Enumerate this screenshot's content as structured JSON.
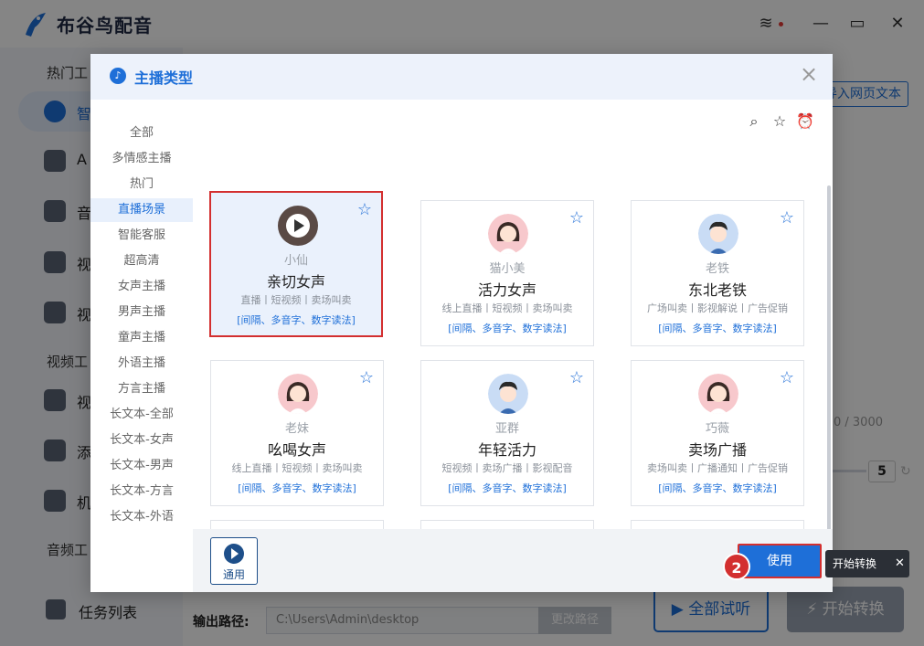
{
  "app": {
    "title": "布谷鸟配音",
    "sections": {
      "hot": "热门工",
      "video": "视频工",
      "audio": "音频工"
    },
    "nav_items": [
      {
        "label": "智",
        "icon": "voice-icon"
      },
      {
        "label": "A",
        "icon": "ai-icon"
      },
      {
        "label": "音",
        "icon": "audio-icon"
      },
      {
        "label": "视",
        "icon": "video-icon"
      },
      {
        "label": "视",
        "icon": "video-voice-icon"
      },
      {
        "label": "视",
        "icon": "video-tool-icon"
      },
      {
        "label": "添",
        "icon": "add-icon"
      },
      {
        "label": "机",
        "icon": "robot-icon"
      }
    ],
    "task_list": "任务列表",
    "import_label": "导入网页文本",
    "char_count": "0 / 3000",
    "speed_value": "5",
    "output_label": "输出路径:",
    "output_path": "C:\\Users\\Admin\\desktop",
    "change_path": "更改路径",
    "trial_all": "全部试听",
    "start_convert": "开始转换"
  },
  "dialog": {
    "title": "主播类型",
    "categories": [
      "全部",
      "多情感主播",
      "热门",
      "直播场景",
      "智能客服",
      "超高清",
      "女声主播",
      "男声主播",
      "童声主播",
      "外语主播",
      "方言主播",
      "长文本-全部",
      "长文本-女声",
      "长文本-男声",
      "长文本-方言",
      "长文本-外语"
    ],
    "active_category": "直播场景",
    "voices": [
      {
        "nick": "小仙",
        "name": "亲切女声",
        "tags": "直播丨短视频丨卖场叫卖",
        "features": "[间隔、多音字、数字读法]",
        "gender": "female",
        "selected": true
      },
      {
        "nick": "猫小美",
        "name": "活力女声",
        "tags": "线上直播丨短视频丨卖场叫卖",
        "features": "[间隔、多音字、数字读法]",
        "gender": "female"
      },
      {
        "nick": "老铁",
        "name": "东北老铁",
        "tags": "广场叫卖丨影视解说丨广告促销",
        "features": "[间隔、多音字、数字读法]",
        "gender": "male"
      },
      {
        "nick": "老妹",
        "name": "吆喝女声",
        "tags": "线上直播丨短视频丨卖场叫卖",
        "features": "[间隔、多音字、数字读法]",
        "gender": "female"
      },
      {
        "nick": "亚群",
        "name": "年轻活力",
        "tags": "短视频丨卖场广播丨影视配音",
        "features": "[间隔、多音字、数字读法]",
        "gender": "male"
      },
      {
        "nick": "巧薇",
        "name": "卖场广播",
        "tags": "卖场叫卖丨广播通知丨广告促销",
        "features": "[间隔、多音字、数字读法]",
        "gender": "female"
      },
      {
        "nick": "",
        "name": "",
        "tags": "",
        "features": "",
        "gender": "male"
      },
      {
        "nick": "",
        "name": "",
        "tags": "",
        "features": "",
        "gender": "male"
      },
      {
        "nick": "",
        "name": "",
        "tags": "",
        "features": "",
        "gender": "female"
      }
    ],
    "general_label": "通用",
    "use_label": "使用",
    "step_number": "2",
    "tooltip": "开始转换",
    "colors": {
      "accent": "#1e6fd8",
      "highlight": "#d32f2f"
    }
  }
}
